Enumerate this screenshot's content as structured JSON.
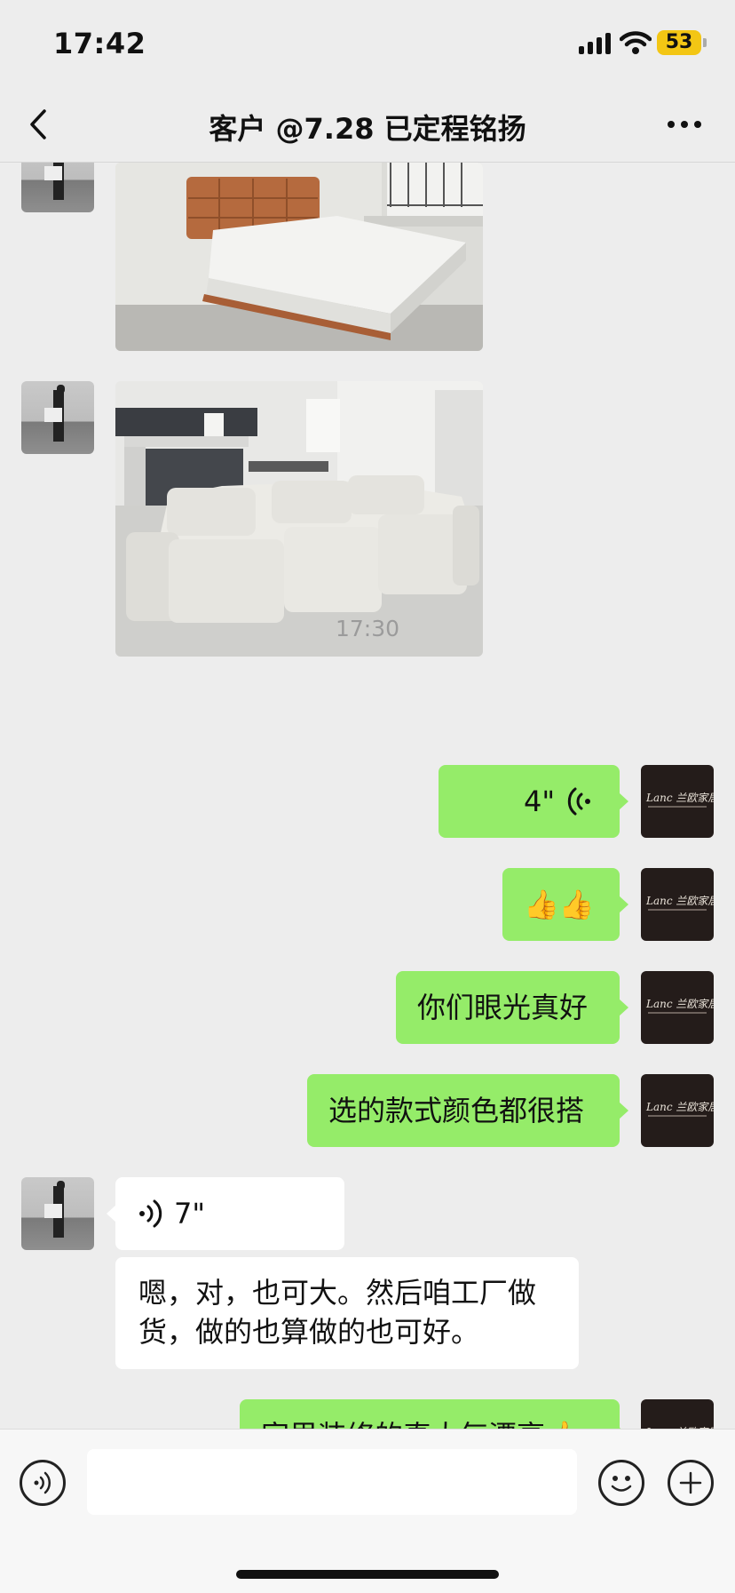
{
  "status_bar": {
    "time": "17:42",
    "battery": "53"
  },
  "nav": {
    "title": "客户 @7.28 已定程铭扬"
  },
  "messages": {
    "timestamp": "17:30",
    "voice_out_duration": "4\"",
    "thumbs": "👍👍",
    "text_out_1": "你们眼光真好",
    "text_out_2": "选的款式颜色都很搭",
    "voice_in_duration": "7\"",
    "text_in_1": "嗯，对，也可大。然后咱工厂做货，做的也算做的也可好。",
    "text_out_3": "家里装修的真大气漂亮👍"
  },
  "shop_avatar": {
    "logo": "Lanc 兰欧家居"
  },
  "icons": {
    "back": "chevron-left-icon",
    "more": "more-dots-icon",
    "voice": "voice-icon",
    "emoji": "emoji-icon",
    "add": "plus-icon"
  },
  "colors": {
    "bubble_out": "#95ec69",
    "bubble_in": "#ffffff",
    "background": "#ededed"
  }
}
